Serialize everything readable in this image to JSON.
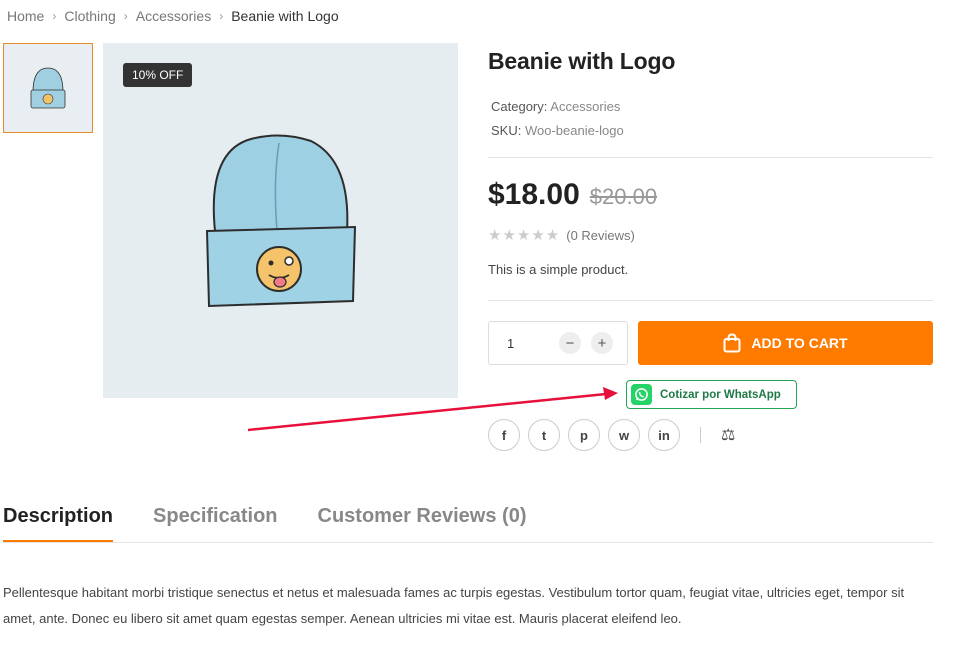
{
  "breadcrumb": {
    "home": "Home",
    "clothing": "Clothing",
    "accessories": "Accessories",
    "current": "Beanie with Logo",
    "separator": ">"
  },
  "product": {
    "badge": "10% OFF",
    "title": "Beanie with Logo",
    "category_label": "Category:",
    "category_value": "Accessories",
    "sku_label": "SKU:",
    "sku_value": "Woo-beanie-logo",
    "price": "$18.00",
    "old_price": "$20.00",
    "stars": "★★★★★",
    "reviews": "(0 Reviews)",
    "short_description": "This is a simple product."
  },
  "cart": {
    "quantity": "1",
    "minus": "−",
    "plus": "+",
    "add_label": "ADD TO CART"
  },
  "whatsapp": {
    "label": "Cotizar por WhatsApp",
    "color": "#25d366"
  },
  "social": {
    "facebook": "f",
    "twitter": "t",
    "pinterest": "p",
    "whatsapp": "w",
    "linkedin": "in"
  },
  "tabs": {
    "description": "Description",
    "specification": "Specification",
    "reviews": "Customer Reviews",
    "reviews_count": "(0)"
  },
  "description": "Pellentesque habitant morbi tristique senectus et netus et malesuada fames ac turpis egestas. Vestibulum tortor quam, feugiat vitae, ultricies eget, tempor sit amet, ante. Donec eu libero sit amet quam egestas semper. Aenean ultricies mi vitae est. Mauris placerat eleifend leo.",
  "colors": {
    "accent": "#ff7b00",
    "arrow": "#e8103a"
  }
}
